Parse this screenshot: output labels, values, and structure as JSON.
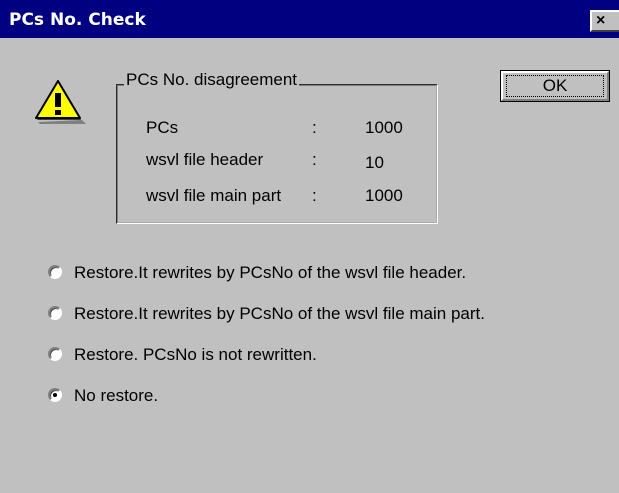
{
  "window": {
    "title": "PCs No. Check",
    "close_glyph": "×"
  },
  "warning_icon": "warning-icon",
  "group": {
    "legend": "PCs No. disagreement",
    "rows": [
      {
        "label": "PCs",
        "sep": ":",
        "value": "1000"
      },
      {
        "label": "wsvl file header",
        "sep": ":",
        "value": "10"
      },
      {
        "label": "wsvl file main part",
        "sep": ":",
        "value": "1000"
      }
    ]
  },
  "ok_button": {
    "label": "OK"
  },
  "options": [
    {
      "label": "Restore.It rewrites by PCsNo of the wsvl file header.",
      "selected": false
    },
    {
      "label": "Restore.It rewrites by PCsNo of the wsvl file main part.",
      "selected": false
    },
    {
      "label": "Restore. PCsNo is not rewritten.",
      "selected": false
    },
    {
      "label": "No restore.",
      "selected": true
    }
  ]
}
